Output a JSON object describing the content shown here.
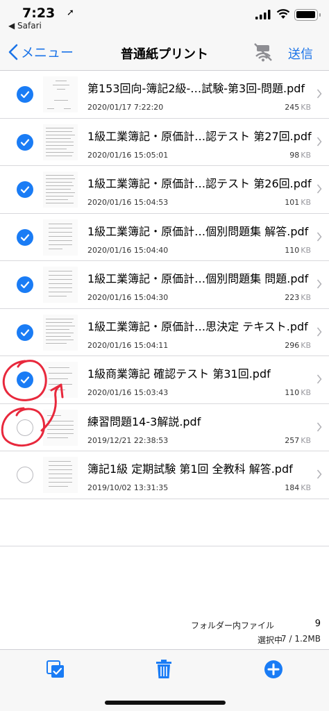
{
  "status_bar": {
    "time": "7:23",
    "back_app": "◀ Safari"
  },
  "nav": {
    "back_label": "メニュー",
    "title": "普通紙プリント",
    "send_label": "送信"
  },
  "files": [
    {
      "name": "第153回向-簿記2級-…試験-第3回-問題.pdf",
      "date": "2020/01/17 7:22:20",
      "size": "245",
      "unit": "KB",
      "selected": true
    },
    {
      "name": "1級工業簿記・原価計…認テスト 第27回.pdf",
      "date": "2020/01/16 15:05:01",
      "size": "98",
      "unit": "KB",
      "selected": true
    },
    {
      "name": "1級工業簿記・原価計…認テスト 第26回.pdf",
      "date": "2020/01/16 15:04:53",
      "size": "101",
      "unit": "KB",
      "selected": true
    },
    {
      "name": "1級工業簿記・原価計…個別問題集 解答.pdf",
      "date": "2020/01/16 15:04:40",
      "size": "110",
      "unit": "KB",
      "selected": true
    },
    {
      "name": "1級工業簿記・原価計…個別問題集 問題.pdf",
      "date": "2020/01/16 15:04:30",
      "size": "223",
      "unit": "KB",
      "selected": true
    },
    {
      "name": "1級工業簿記・原価計…思決定 テキスト.pdf",
      "date": "2020/01/16 15:04:11",
      "size": "296",
      "unit": "KB",
      "selected": true
    },
    {
      "name": "1級商業簿記 確認テスト 第31回.pdf",
      "date": "2020/01/16 15:03:43",
      "size": "110",
      "unit": "KB",
      "selected": true
    },
    {
      "name": "練習問題14-3解説.pdf",
      "date": "2019/12/21 22:38:53",
      "size": "257",
      "unit": "KB",
      "selected": false
    },
    {
      "name": "簿記1級 定期試験 第1回 全教科 解答.pdf",
      "date": "2019/10/02 13:31:35",
      "size": "184",
      "unit": "KB",
      "selected": false
    }
  ],
  "footer": {
    "folder_files_label": "フォルダー内ファイル",
    "folder_files_count": "9",
    "selected_label": "選択中",
    "selected_value": "7 / 1.2MB"
  },
  "icons": {
    "select_all": "select-all-icon",
    "delete": "trash-icon",
    "add": "add-icon",
    "no_printer": "printer-offline-icon"
  },
  "colors": {
    "accent": "#1a7cf5",
    "annotation": "#e8283c"
  }
}
